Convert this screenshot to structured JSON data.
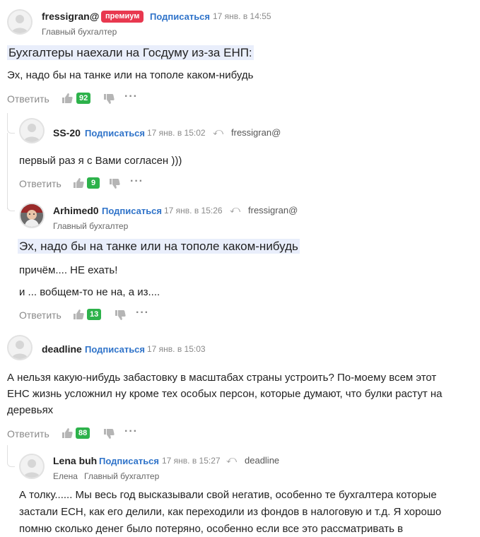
{
  "comments": [
    {
      "author": "fressigran@",
      "badge": "премиум",
      "subscribe": "Подписаться",
      "time": "17 янв. в 14:55",
      "role": "Главный бухгалтер",
      "quote": "Бухгалтеры наехали на Госдуму из-за ЕНП:",
      "lines": [
        "Эх, надо бы на танке или на тополе каком-нибудь"
      ],
      "reply_label": "Ответить",
      "likes": "92"
    },
    {
      "author": "SS-20",
      "subscribe": "Подписаться",
      "time": "17 янв. в 15:02",
      "reply_to": "fressigran@",
      "lines": [
        "первый раз я с Вами согласен )))"
      ],
      "reply_label": "Ответить",
      "likes": "9"
    },
    {
      "author": "Arhimed0",
      "subscribe": "Подписаться",
      "time": "17 янв. в 15:26",
      "reply_to": "fressigran@",
      "role": "Главный бухгалтер",
      "quote": "Эх, надо бы на танке или на тополе каком-нибудь",
      "lines": [
        "причём.... НЕ ехать!",
        "и ... вобщем-то не на, а из...."
      ],
      "reply_label": "Ответить",
      "likes": "13"
    },
    {
      "author": "deadline",
      "subscribe": "Подписаться",
      "time": "17 янв. в 15:03",
      "lines": [
        "А нельзя какую-нибудь забастовку в масштабах страны устроить? По-моему всем этот",
        "ЕНС жизнь усложнил ну кроме тех особых персон, которые думают, что булки растут на",
        "деревьях"
      ],
      "reply_label": "Ответить",
      "likes": "88"
    },
    {
      "author": "Lena buh",
      "subscribe": "Подписаться",
      "time": "17 янв. в 15:27",
      "reply_to": "deadline",
      "name": "Елена",
      "role": "Главный бухгалтер",
      "lines": [
        "А толку...... Мы весь год высказывали свой негатив, особенно те бухгалтера которые",
        "застали ЕСН, как его делили, как переходили из фондов в налоговую и т.д. Я хорошо",
        "помню сколько денег было потеряно, особенно если все это рассматривать в"
      ]
    }
  ],
  "icons": {
    "like": "thumbs-up-icon",
    "dislike": "thumbs-down-icon",
    "reply_arrow": "reply-arrow-icon",
    "more": "more-dots-icon"
  },
  "colors": {
    "badge": "#e8384f",
    "subscribe": "#2f73c9",
    "like_count": "#2db24b",
    "quote_bg": "#e9eefb"
  }
}
